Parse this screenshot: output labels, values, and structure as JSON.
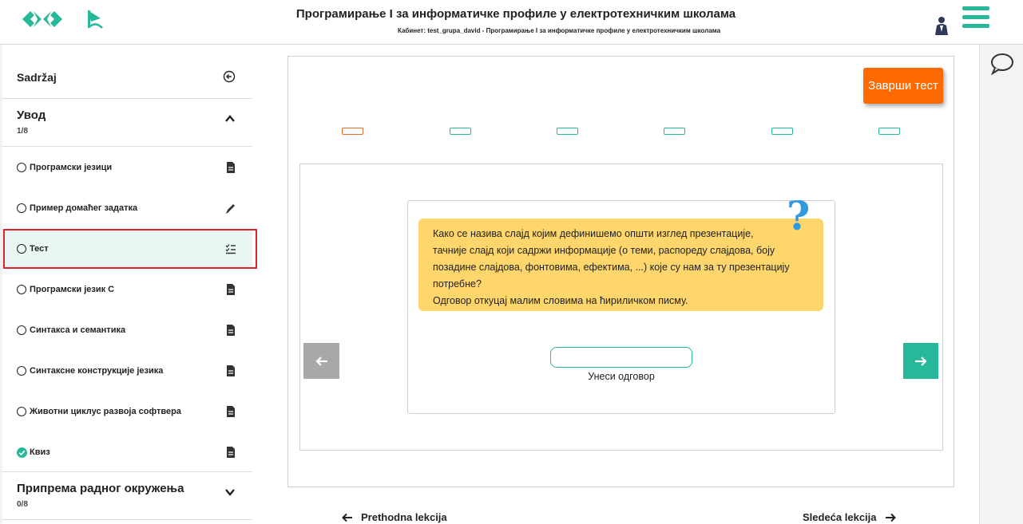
{
  "header": {
    "title": "Програмирање I за информатичке профиле у електротехничким школама",
    "subtitle": "Кабинет: test_grupa_david - Програмирање I за информатичке профиле у електротехничким школама"
  },
  "sidebar": {
    "heading": "Sadržaj",
    "sections": [
      {
        "title": "Увод",
        "count": "1/8",
        "expanded": true,
        "items": [
          {
            "label": "Програмски језици",
            "icon": "document-icon",
            "done": false
          },
          {
            "label": "Пример домаћег задатка",
            "icon": "pencil-icon",
            "done": false
          },
          {
            "label": "Тест",
            "icon": "checklist-icon",
            "done": false,
            "active": true
          },
          {
            "label": "Програмски језик C",
            "icon": "document-icon",
            "done": false
          },
          {
            "label": "Синтакса и семантика",
            "icon": "document-icon",
            "done": false
          },
          {
            "label": "Синтаксне конструкције језика",
            "icon": "document-icon",
            "done": false
          },
          {
            "label": "Животни циклус развоја софтвера",
            "icon": "document-icon",
            "done": false
          },
          {
            "label": "Квиз",
            "icon": "document-icon",
            "done": true
          }
        ]
      },
      {
        "title": "Припрема радног окружења",
        "count": "0/8",
        "expanded": false
      }
    ]
  },
  "quiz": {
    "finish_label": "Заврши тест",
    "question_count": 6,
    "current_question": 1,
    "question_lines": [
      "Како се назива слајд којим дефинишемо општи изглед презентације,",
      "тачније слајд који садржи информације (о теми, распореду слајдова, боју",
      "позадине слајдова, фонтовима, ефектима, ...) које су нам за ту презентацију",
      "потребне?",
      "Одговор откуцај малим словима на ћириличком писму."
    ],
    "answer_value": "",
    "answer_label": "Унеси одговор"
  },
  "lesson_nav": {
    "prev_label": "Prethodna lekcija",
    "next_label": "Sledeća lekcija"
  },
  "colors": {
    "accent": "#27b89a",
    "orange": "#fd6a00",
    "bubble": "#fed66c",
    "question_mark": "#2e9ae0",
    "highlight": "#d9262b"
  }
}
